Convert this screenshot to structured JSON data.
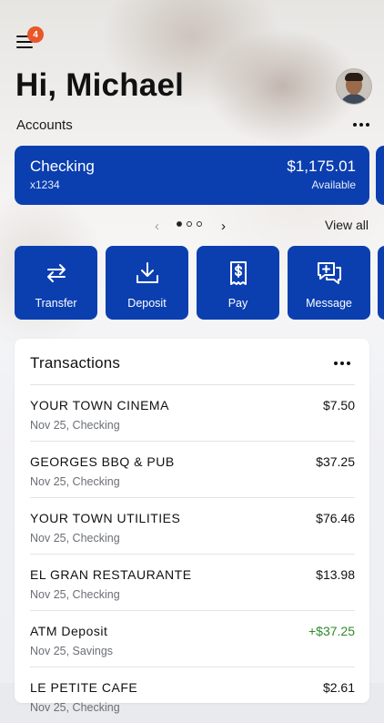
{
  "header": {
    "notification_count": "4",
    "greeting": "Hi, Michael"
  },
  "accounts": {
    "section_label": "Accounts",
    "cards": [
      {
        "name": "Checking",
        "number": "x1234",
        "balance": "$1,175.01",
        "balance_label": "Available"
      }
    ],
    "pager": {
      "page_count": 3,
      "current_page": 1
    },
    "view_all_label": "View all"
  },
  "quick_actions": [
    {
      "label": "Transfer",
      "icon": "transfer-arrows-icon"
    },
    {
      "label": "Deposit",
      "icon": "download-tray-icon"
    },
    {
      "label": "Pay",
      "icon": "receipt-dollar-icon"
    },
    {
      "label": "Message",
      "icon": "chat-plus-icon"
    }
  ],
  "transactions": {
    "title": "Transactions",
    "rows": [
      {
        "merchant": "YOUR TOWN CINEMA",
        "meta": "Nov 25, Checking",
        "amount": "$7.50",
        "type": "debit"
      },
      {
        "merchant": "GEORGES BBQ & PUB",
        "meta": "Nov 25, Checking",
        "amount": "$37.25",
        "type": "debit"
      },
      {
        "merchant": "YOUR TOWN UTILITIES",
        "meta": "Nov 25, Checking",
        "amount": "$76.46",
        "type": "debit"
      },
      {
        "merchant": "EL GRAN RESTAURANTE",
        "meta": "Nov 25, Checking",
        "amount": "$13.98",
        "type": "debit"
      },
      {
        "merchant": "ATM Deposit",
        "meta": "Nov 25, Savings",
        "amount": "+$37.25",
        "type": "credit"
      },
      {
        "merchant": "LE PETITE CAFE",
        "meta": "Nov 25, Checking",
        "amount": "$2.61",
        "type": "debit"
      }
    ]
  },
  "colors": {
    "brand_blue": "#0b3fb0",
    "badge_orange": "#e8562a",
    "credit_green": "#2f8a2a"
  }
}
